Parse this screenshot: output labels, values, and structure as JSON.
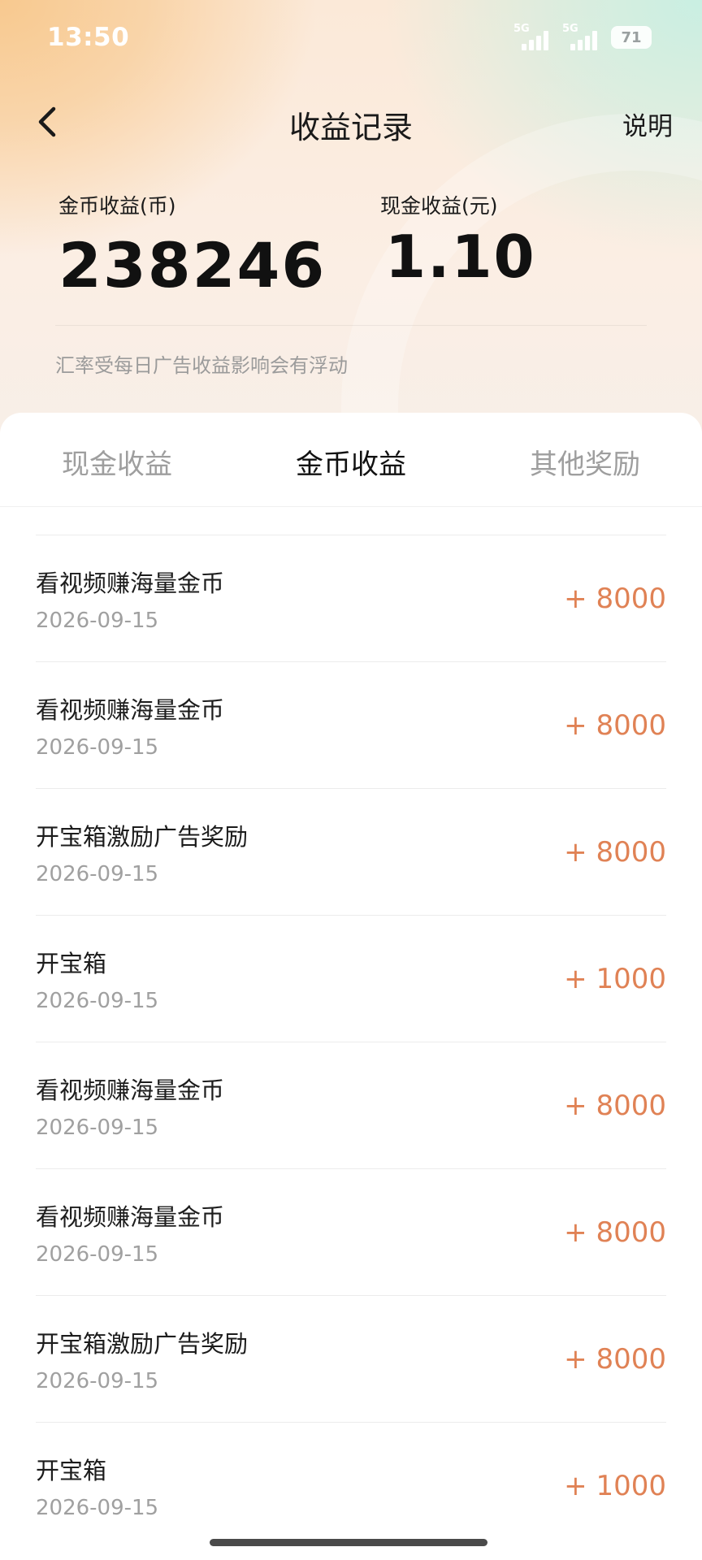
{
  "status_bar": {
    "time": "13:50",
    "signal_1": "5G",
    "signal_2": "5G",
    "battery": "71"
  },
  "nav": {
    "back_icon": "chevron-left-icon",
    "title": "收益记录",
    "help_label": "说明"
  },
  "summary": {
    "coin_label": "金币收益(币)",
    "coin_value": "238246",
    "cash_label": "现金收益(元)",
    "cash_value": "1.10",
    "rate_note": "汇率受每日广告收益影响会有浮动"
  },
  "tabs": [
    {
      "label": "现金收益",
      "active": false
    },
    {
      "label": "金币收益",
      "active": true
    },
    {
      "label": "其他奖励",
      "active": false
    }
  ],
  "records": [
    {
      "title": "看视频赚海量金币",
      "date": "2026-09-15",
      "amount": "+ 8000"
    },
    {
      "title": "看视频赚海量金币",
      "date": "2026-09-15",
      "amount": "+ 8000"
    },
    {
      "title": "开宝箱激励广告奖励",
      "date": "2026-09-15",
      "amount": "+ 8000"
    },
    {
      "title": "开宝箱",
      "date": "2026-09-15",
      "amount": "+ 1000"
    },
    {
      "title": "看视频赚海量金币",
      "date": "2026-09-15",
      "amount": "+ 8000"
    },
    {
      "title": "看视频赚海量金币",
      "date": "2026-09-15",
      "amount": "+ 8000"
    },
    {
      "title": "开宝箱激励广告奖励",
      "date": "2026-09-15",
      "amount": "+ 8000"
    },
    {
      "title": "开宝箱",
      "date": "2026-09-15",
      "amount": "+ 1000"
    }
  ],
  "colors": {
    "amount": "#e08255",
    "tab_active": "#111111",
    "tab_inactive": "#9e9e9e"
  }
}
